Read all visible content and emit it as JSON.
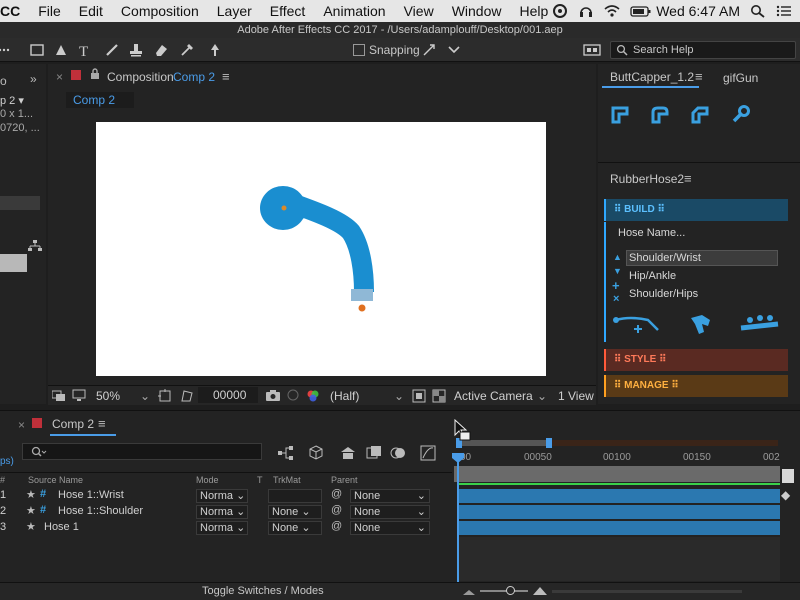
{
  "menubar": {
    "app_fragment": "CC",
    "items": [
      "File",
      "Edit",
      "Composition",
      "Layer",
      "Effect",
      "Animation",
      "View",
      "Window",
      "Help"
    ],
    "clock": "Wed 6:47 AM"
  },
  "window": {
    "title": "Adobe After Effects CC 2017 - /Users/adamplouff/Desktop/001.aep"
  },
  "toolbar": {
    "snapping_label": "Snapping",
    "search_placeholder": "Search Help"
  },
  "project_panel": {
    "name_fragment": "p 2 ▾",
    "line2": "0 x 1...",
    "line3": "0720, ..."
  },
  "comp_panel": {
    "tab_prefix": "Composition",
    "tab_name": "Comp 2",
    "subtab": "Comp 2"
  },
  "viewer_bar": {
    "zoom": "50%",
    "timecode": "00000",
    "resolution": "(Half)",
    "camera": "Active Camera",
    "views": "1 View"
  },
  "right_panel": {
    "tab_active": "ButtCapper_1.2",
    "tab_other": "gifGun",
    "rubberhose_title": "RubberHose2",
    "build_label": "BUILD",
    "hose_name_placeholder": "Hose Name...",
    "hose_list": [
      "Shoulder/Wrist",
      "Hip/Ankle",
      "Shoulder/Hips"
    ],
    "style_label": "STYLE",
    "manage_label": "MANAGE"
  },
  "timeline": {
    "tab_name": "Comp 2",
    "fps_fragment": "ps)",
    "headers": {
      "num": "#",
      "source_name": "Source Name",
      "mode": "Mode",
      "t": "T",
      "trkmat": "TrkMat",
      "parent": "Parent"
    },
    "ruler": [
      "00",
      "00050",
      "00100",
      "00150",
      "002"
    ],
    "layers": [
      {
        "num": "1",
        "name": "Hose 1::Wrist",
        "mode": "Norma",
        "trkmat": "",
        "parent": "None"
      },
      {
        "num": "2",
        "name": "Hose 1::Shoulder",
        "mode": "Norma",
        "trkmat": "None",
        "parent": "None"
      },
      {
        "num": "3",
        "name": "Hose 1",
        "mode": "Norma",
        "trkmat": "None",
        "parent": "None"
      }
    ],
    "toggle_label": "Toggle Switches / Modes"
  },
  "colors": {
    "accent_blue": "#4a9ce8",
    "hose_blue": "#1a8ed0",
    "layer_bar": "#2b78b0",
    "build_header": "#1a4a66",
    "style_header": "#5a2a22",
    "manage_header": "#5a3a16"
  }
}
